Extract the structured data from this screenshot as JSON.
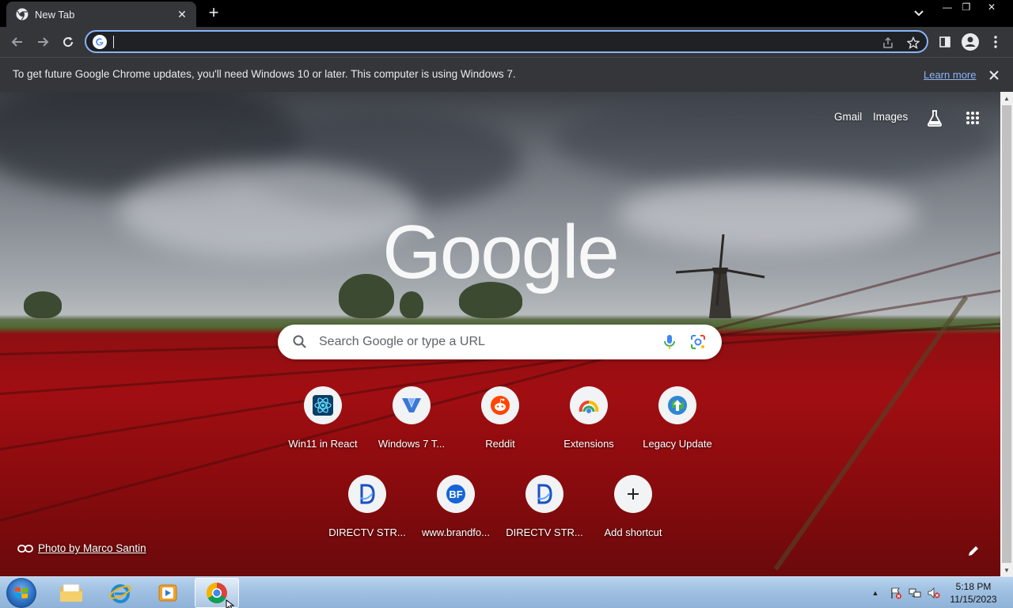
{
  "browser": {
    "tab_title": "New Tab",
    "tab_close": "✕",
    "new_tab": "+",
    "window_minimize": "—",
    "window_restore": "❐",
    "window_close": "✕",
    "omnibox_value": "",
    "accent_color": "#8ab4f8"
  },
  "infobar": {
    "message": "To get future Google Chrome updates, you'll need Windows 10 or later. This computer is using Windows 7.",
    "link": "Learn more"
  },
  "ntp": {
    "header_links": [
      "Gmail",
      "Images"
    ],
    "logo": "Google",
    "search_placeholder": "Search Google or type a URL",
    "shortcuts": [
      {
        "label": "Win11 in React",
        "icon": "win11-react-icon"
      },
      {
        "label": "Windows 7 T...",
        "icon": "windows7-v-icon"
      },
      {
        "label": "Reddit",
        "icon": "reddit-icon"
      },
      {
        "label": "Extensions",
        "icon": "chrome-extensions-icon"
      },
      {
        "label": "Legacy Update",
        "icon": "legacy-update-icon"
      },
      {
        "label": "DIRECTV STR...",
        "icon": "directv-icon"
      },
      {
        "label": "www.brandfo...",
        "icon": "brandfolder-icon"
      },
      {
        "label": "DIRECTV STR...",
        "icon": "directv-icon"
      },
      {
        "label": "Add shortcut",
        "icon": "plus-icon"
      }
    ],
    "attribution": "Photo by Marco Santin"
  },
  "taskbar": {
    "time": "5:18 PM",
    "date": "11/15/2023",
    "tray_arrow": "▲"
  }
}
